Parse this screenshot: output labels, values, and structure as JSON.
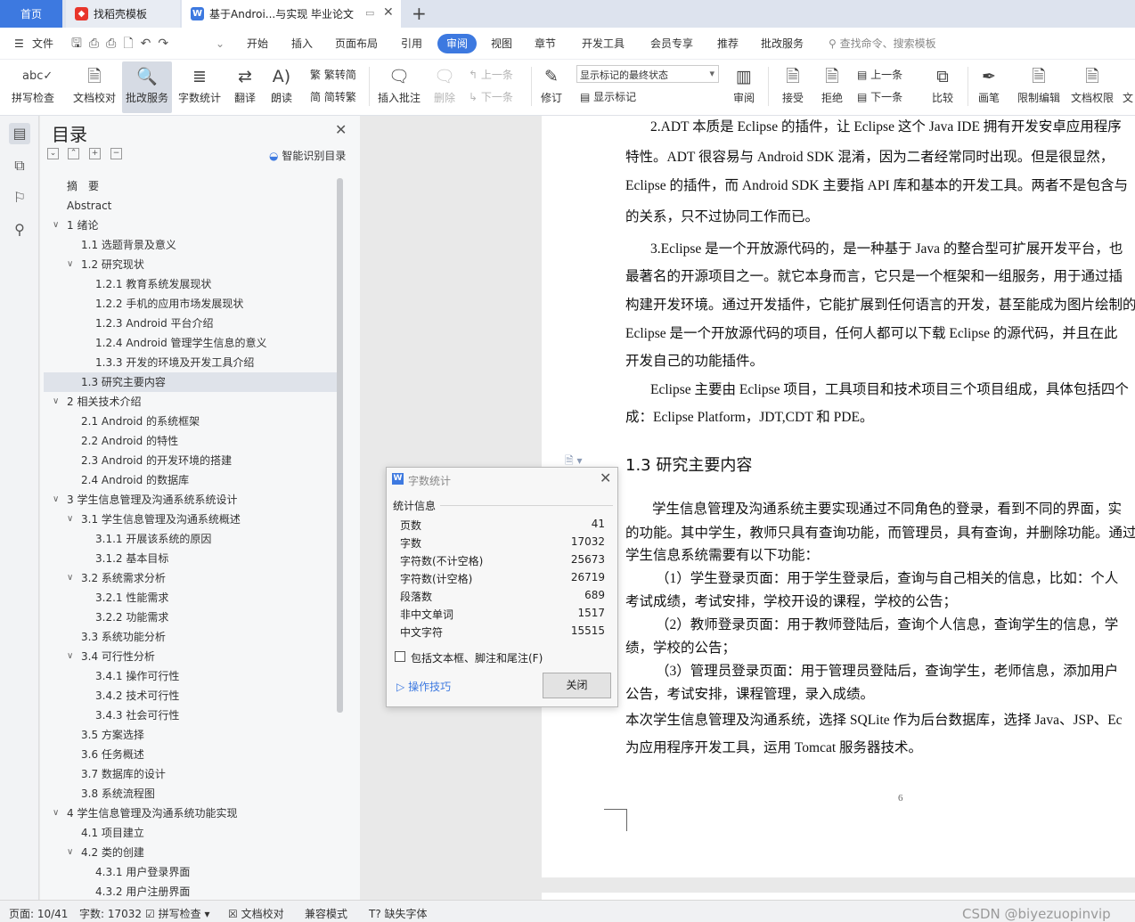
{
  "tabs": {
    "home": "首页",
    "template": "找稻壳模板",
    "doc": "基于Androi...与实现 毕业论文",
    "new_tab": "+"
  },
  "menu": {
    "file": "文件",
    "items": [
      "开始",
      "插入",
      "页面布局",
      "引用",
      "审阅",
      "视图",
      "章节",
      "开发工具",
      "会员专享",
      "推荐",
      "批改服务"
    ],
    "search_placeholder": "查找命令、搜索模板"
  },
  "ribbon": {
    "spell": "拼写检查",
    "proof": "文档校对",
    "correct": "批改服务",
    "wordcount": "字数统计",
    "translate": "翻译",
    "read": "朗读",
    "trad": "繁转简",
    "simp": "简转繁",
    "insert_comment": "插入批注",
    "delete": "删除",
    "prev_comment": "上一条",
    "next_comment": "下一条",
    "revise": "修订",
    "markup_state": "显示标记的最终状态",
    "show_markup": "显示标记",
    "review": "审阅",
    "accept": "接受",
    "reject": "拒绝",
    "prev": "上一条",
    "next": "下一条",
    "compare": "比较",
    "pen": "画笔",
    "restrict": "限制编辑",
    "perm": "文档权限",
    "more": "文"
  },
  "toc": {
    "title": "目录",
    "smart": "智能识别目录",
    "items": [
      {
        "text": "摘　要",
        "level": 1,
        "arrow": ""
      },
      {
        "text": "Abstract",
        "level": 1,
        "arrow": ""
      },
      {
        "text": "1  绪论",
        "level": 1,
        "arrow": "v"
      },
      {
        "text": "1.1  选题背景及意义",
        "level": 2,
        "arrow": ""
      },
      {
        "text": "1.2  研究现状",
        "level": 2,
        "arrow": "v"
      },
      {
        "text": "1.2.1  教育系统发展现状",
        "level": 3,
        "arrow": ""
      },
      {
        "text": "1.2.2  手机的应用市场发展现状",
        "level": 3,
        "arrow": ""
      },
      {
        "text": "1.2.3 Android 平台介绍",
        "level": 3,
        "arrow": ""
      },
      {
        "text": "1.2.4 Android 管理学生信息的意义",
        "level": 3,
        "arrow": ""
      },
      {
        "text": "1.3.3  开发的环境及开发工具介绍",
        "level": 3,
        "arrow": ""
      },
      {
        "text": "1.3  研究主要内容",
        "level": 2,
        "arrow": "",
        "selected": true
      },
      {
        "text": "2  相关技术介绍",
        "level": 1,
        "arrow": "v"
      },
      {
        "text": "2.1 Android 的系统框架",
        "level": 2,
        "arrow": ""
      },
      {
        "text": "2.2 Android 的特性",
        "level": 2,
        "arrow": ""
      },
      {
        "text": "2.3 Android 的开发环境的搭建",
        "level": 2,
        "arrow": ""
      },
      {
        "text": "2.4 Android 的数据库",
        "level": 2,
        "arrow": ""
      },
      {
        "text": "3  学生信息管理及沟通系统系统设计",
        "level": 1,
        "arrow": "v"
      },
      {
        "text": "3.1  学生信息管理及沟通系统概述",
        "level": 2,
        "arrow": "v"
      },
      {
        "text": "3.1.1 开展该系统的原因",
        "level": 3,
        "arrow": ""
      },
      {
        "text": "3.1.2  基本目标",
        "level": 3,
        "arrow": ""
      },
      {
        "text": "3.2  系统需求分析",
        "level": 2,
        "arrow": "v"
      },
      {
        "text": "3.2.1  性能需求",
        "level": 3,
        "arrow": ""
      },
      {
        "text": "3.2.2  功能需求",
        "level": 3,
        "arrow": ""
      },
      {
        "text": "3.3  系统功能分析",
        "level": 2,
        "arrow": ""
      },
      {
        "text": "3.4  可行性分析",
        "level": 2,
        "arrow": "v"
      },
      {
        "text": "3.4.1 操作可行性",
        "level": 3,
        "arrow": ""
      },
      {
        "text": "3.4.2 技术可行性",
        "level": 3,
        "arrow": ""
      },
      {
        "text": "3.4.3 社会可行性",
        "level": 3,
        "arrow": ""
      },
      {
        "text": "3.5  方案选择",
        "level": 2,
        "arrow": ""
      },
      {
        "text": "3.6  任务概述",
        "level": 2,
        "arrow": ""
      },
      {
        "text": "3.7  数据库的设计",
        "level": 2,
        "arrow": ""
      },
      {
        "text": "3.8  系统流程图",
        "level": 2,
        "arrow": ""
      },
      {
        "text": "4  学生信息管理及沟通系统功能实现",
        "level": 1,
        "arrow": "v"
      },
      {
        "text": "4.1  项目建立",
        "level": 2,
        "arrow": ""
      },
      {
        "text": "4.2  类的创建",
        "level": 2,
        "arrow": "v"
      },
      {
        "text": "4.3.1  用户登录界面",
        "level": 3,
        "arrow": ""
      },
      {
        "text": "4.3.2  用户注册界面",
        "level": 3,
        "arrow": ""
      }
    ]
  },
  "document": {
    "lines": [
      "2.ADT 本质是 Eclipse 的插件，让 Eclipse 这个 Java IDE 拥有开发安卓应用程序",
      "特性。ADT 很容易与 Android SDK 混淆，因为二者经常同时出现。但是很显然，",
      "Eclipse 的插件，而 Android SDK 主要指 API 库和基本的开发工具。两者不是包含与",
      "的关系，只不过协同工作而已。",
      "3.Eclipse  是一个开放源代码的，是一种基于 Java 的整合型可扩展开发平台，也",
      "最著名的开源项目之一。就它本身而言，它只是一个框架和一组服务，用于通过插",
      "构建开发环境。通过开发插件，它能扩展到任何语言的开发，甚至能成为图片绘制的",
      "Eclipse 是一个开放源代码的项目，任何人都可以下载 Eclipse 的源代码，并且在此",
      "开发自己的功能插件。",
      "Eclipse 主要由 Eclipse 项目，工具项目和技术项目三个项目组成，具体包括四个",
      "成：Eclipse Platform，JDT,CDT 和 PDE。"
    ],
    "heading": "1.3  研究主要内容",
    "lines2": [
      "学生信息管理及沟通系统主要实现通过不同角色的登录，看到不同的界面，实",
      "的功能。其中学生，教师只具有查询功能，而管理员，具有查询，并删除功能。通过",
      "学生信息系统需要有以下功能：",
      "（1）学生登录页面：用于学生登录后，查询与自己相关的信息，比如：个人",
      "考试成绩，考试安排，学校开设的课程，学校的公告；",
      "（2）教师登录页面：用于教师登陆后，查询个人信息，查询学生的信息，学",
      "绩，学校的公告；",
      "（3）管理员登录页面：用于管理员登陆后，查询学生，老师信息，添加用户",
      "公告，考试安排，课程管理，录入成绩。",
      "本次学生信息管理及沟通系统，选择 SQLite 作为后台数据库，选择 Java、JSP、Ec",
      "为应用程序开发工具，运用 Tomcat 服务器技术。"
    ],
    "page_number": "6"
  },
  "dialog": {
    "title": "字数统计",
    "section": "统计信息",
    "stats": [
      {
        "label": "页数",
        "value": "41"
      },
      {
        "label": "字数",
        "value": "17032"
      },
      {
        "label": "字符数(不计空格)",
        "value": "25673"
      },
      {
        "label": "字符数(计空格)",
        "value": "26719"
      },
      {
        "label": "段落数",
        "value": "689"
      },
      {
        "label": "非中文单词",
        "value": "1517"
      },
      {
        "label": "中文字符",
        "value": "15515"
      }
    ],
    "include_label": "包括文本框、脚注和尾注(F)",
    "tips": "操作技巧",
    "close": "关闭"
  },
  "status": {
    "page": "页面: 10/41",
    "words": "字数: 17032",
    "spell": "拼写检查",
    "proof": "文档校对",
    "compat": "兼容模式",
    "missing_font": "缺失字体",
    "watermark": "CSDN @biyezuopinvip"
  }
}
